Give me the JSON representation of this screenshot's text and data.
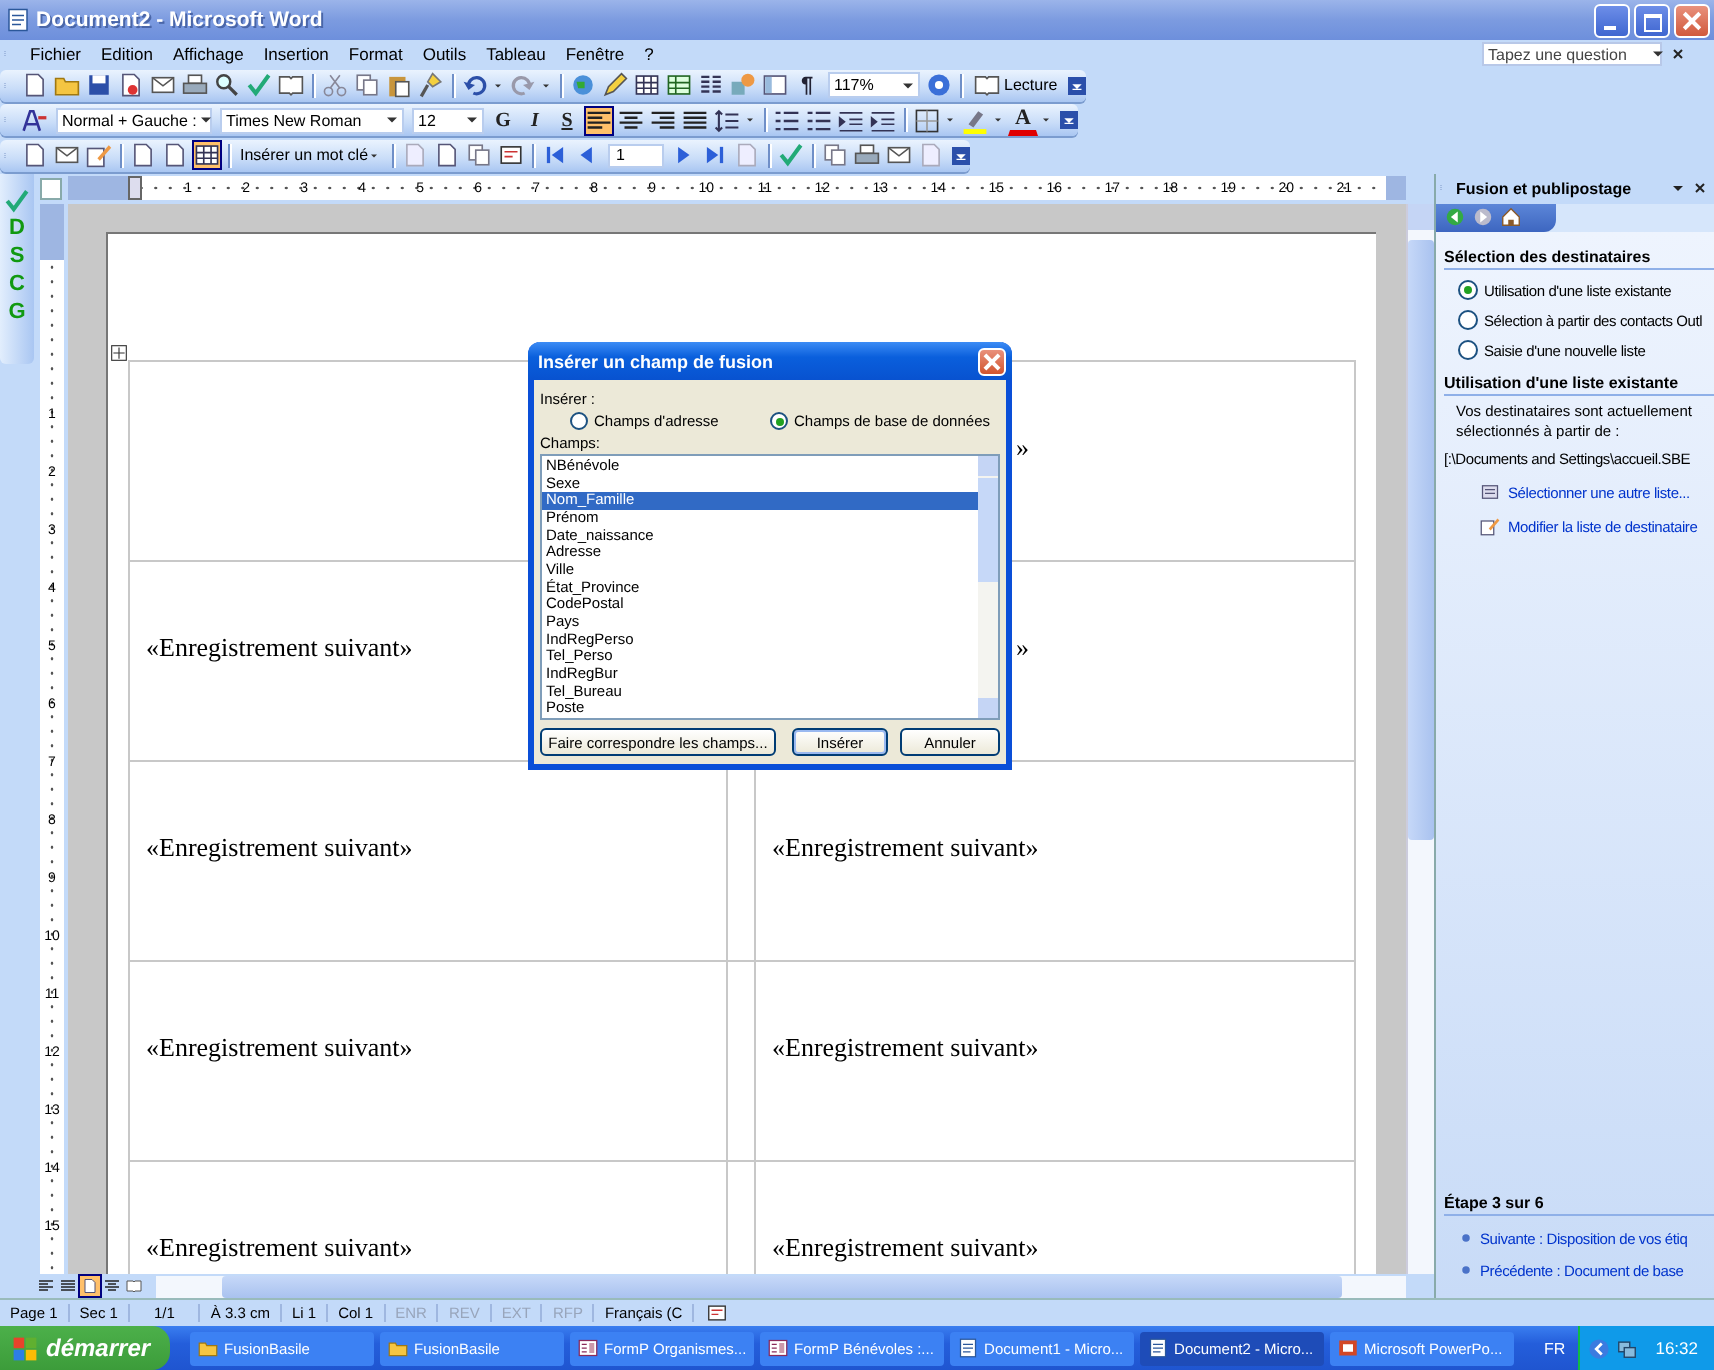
{
  "window": {
    "title": "Document2 - Microsoft Word"
  },
  "menu": [
    "Fichier",
    "Edition",
    "Affichage",
    "Insertion",
    "Format",
    "Outils",
    "Tableau",
    "Fenêtre",
    "?"
  ],
  "help_box": {
    "placeholder": "Tapez une question"
  },
  "standard_toolbar": {
    "pilcrow": "¶",
    "zoom": "117%",
    "reading_button": "Lecture"
  },
  "formatting_toolbar": {
    "style": "Normal + Gauche :",
    "font": "Times New Roman",
    "size": "12",
    "buttons": [
      {
        "label": "G",
        "selected": false
      },
      {
        "label": "I",
        "selected": false
      },
      {
        "label": "S",
        "selected": false
      }
    ],
    "alignments": [
      {
        "selected": true
      },
      {
        "selected": false
      },
      {
        "selected": false
      },
      {
        "selected": false
      }
    ],
    "font_color_letter": "A"
  },
  "mail_merge_toolbar": {
    "buttons": [
      {
        "selected": false
      },
      {
        "selected": false
      },
      {
        "selected": true
      }
    ],
    "keyword_button": "Insérer un mot clé",
    "record": "1"
  },
  "side_toolbar": {
    "letters": [
      "D",
      "S",
      "C",
      "G"
    ]
  },
  "ruler": {
    "numbers": [
      "1",
      "2",
      "3",
      "4",
      "5",
      "6",
      "7",
      "8",
      "9",
      "10",
      "11",
      "12",
      "13",
      "14",
      "15",
      "16",
      "17",
      "18",
      "19",
      "20",
      "21"
    ]
  },
  "vertical_ruler": {
    "numbers": [
      "1",
      "2",
      "3",
      "4",
      "5",
      "6",
      "7",
      "8",
      "9",
      "10",
      "11",
      "12",
      "13",
      "14",
      "15"
    ]
  },
  "document": {
    "rows": [
      {
        "cells": [
          {},
          {
            "text": "»",
            "covered": true
          }
        ]
      },
      {
        "cells": [
          {
            "text": "«Enregistrement suivant»"
          },
          {
            "text": "»",
            "covered": true
          }
        ]
      },
      {
        "cells": [
          {
            "text": "«Enregistrement suivant»"
          },
          {
            "text": "«Enregistrement suivant»"
          }
        ]
      },
      {
        "cells": [
          {
            "text": "«Enregistrement suivant»"
          },
          {
            "text": "«Enregistrement suivant»"
          }
        ]
      },
      {
        "cells": [
          {
            "text": "«Enregistrement suivant»"
          },
          {
            "text": "«Enregistrement suivant»"
          }
        ]
      }
    ]
  },
  "dialog": {
    "title": "Insérer un champ de fusion",
    "insert_label": "Insérer :",
    "options": [
      {
        "label": "Champs d'adresse",
        "selected": false
      },
      {
        "label": "Champs de base de données",
        "selected": true
      }
    ],
    "fields_label": "Champs:",
    "fields": [
      {
        "label": "NBénévole",
        "selected": false
      },
      {
        "label": "Sexe",
        "selected": false
      },
      {
        "label": "Nom_Famille",
        "selected": true
      },
      {
        "label": "Prénom",
        "selected": false
      },
      {
        "label": "Date_naissance",
        "selected": false
      },
      {
        "label": "Adresse",
        "selected": false
      },
      {
        "label": "Ville",
        "selected": false
      },
      {
        "label": "État_Province",
        "selected": false
      },
      {
        "label": "CodePostal",
        "selected": false
      },
      {
        "label": "Pays",
        "selected": false
      },
      {
        "label": "IndRegPerso",
        "selected": false
      },
      {
        "label": "Tel_Perso",
        "selected": false
      },
      {
        "label": "IndRegBur",
        "selected": false
      },
      {
        "label": "Tel_Bureau",
        "selected": false
      },
      {
        "label": "Poste",
        "selected": false
      }
    ],
    "buttons": [
      {
        "label": "Faire correspondre les champs...",
        "default": false
      },
      {
        "label": "Insérer",
        "default": true
      },
      {
        "label": "Annuler",
        "default": false
      }
    ]
  },
  "task_pane": {
    "title": "Fusion et publipostage",
    "section_1": "Sélection des destinataires",
    "options": [
      {
        "label": "Utilisation d'une liste existante",
        "selected": true
      },
      {
        "label": "Sélection à partir des contacts Outl",
        "selected": false
      },
      {
        "label": "Saisie d'une nouvelle liste",
        "selected": false
      }
    ],
    "section_2": "Utilisation d'une liste existante",
    "description": "Vos destinataires sont actuellement sélectionnés à partir de :",
    "path": "[:\\Documents and Settings\\accueil.SBE",
    "links": [
      "Sélectionner une autre liste...",
      "Modifier la liste de destinataire"
    ],
    "step": "Étape 3 sur 6",
    "next": "Suivante : Disposition de vos étiq",
    "previous": "Précédente : Document de base"
  },
  "status_bar": {
    "items": [
      {
        "text": "Page 1",
        "disabled": false
      },
      {
        "text": "Sec 1",
        "disabled": false
      },
      {
        "text": "1/1",
        "disabled": false
      },
      {
        "text": "À 3.3 cm",
        "disabled": false
      },
      {
        "text": "Li 1",
        "disabled": false
      },
      {
        "text": "Col 1",
        "disabled": false
      },
      {
        "text": "ENR",
        "disabled": true
      },
      {
        "text": "REV",
        "disabled": true
      },
      {
        "text": "EXT",
        "disabled": true
      },
      {
        "text": "RFP",
        "disabled": true
      },
      {
        "text": "Français (C",
        "disabled": false
      }
    ]
  },
  "taskbar": {
    "start": "démarrer",
    "tasks": [
      {
        "label": "FusionBasile",
        "kind": "folder",
        "selected": false
      },
      {
        "label": "FusionBasile",
        "kind": "folder",
        "selected": false
      },
      {
        "label": "FormP Organismes...",
        "kind": "form",
        "selected": false
      },
      {
        "label": "FormP Bénévoles :...",
        "kind": "form",
        "selected": false
      },
      {
        "label": "Document1 - Micro...",
        "kind": "document",
        "selected": false
      },
      {
        "label": "Document2 - Micro...",
        "kind": "document",
        "selected": true
      },
      {
        "label": "Microsoft PowerPo...",
        "kind": "presentation",
        "selected": false
      }
    ],
    "language": "FR",
    "clock": "16:32"
  }
}
